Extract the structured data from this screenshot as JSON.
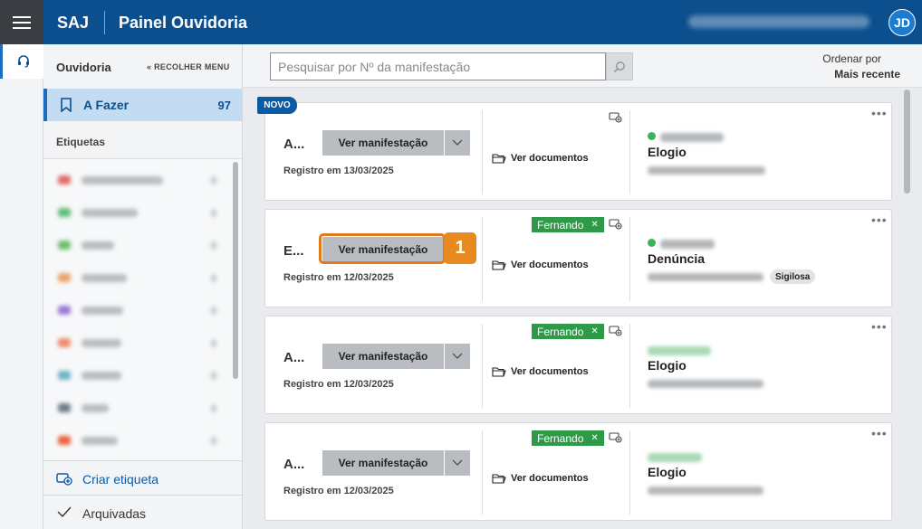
{
  "header": {
    "brand": "SAJ",
    "title": "Painel Ouvidoria",
    "avatar_initials": "JD"
  },
  "sidebar": {
    "title": "Ouvidoria",
    "collapse_label": "RECOLHER MENU",
    "afazer_label": "A Fazer",
    "afazer_count": "97",
    "tags_title": "Etiquetas",
    "create_label": "Criar etiqueta",
    "archived_label": "Arquivadas"
  },
  "search": {
    "placeholder": "Pesquisar por Nº da manifestação"
  },
  "sort": {
    "label": "Ordenar por",
    "value": "Mais recente"
  },
  "cards": [
    {
      "title": "A...",
      "badge": "NOVO",
      "button": "Ver manifestação",
      "registro": "Registro em 13/03/2025",
      "docs": "Ver documentos",
      "tag": "",
      "type": "Elogio",
      "confidential": ""
    },
    {
      "title": "E...",
      "badge": "",
      "button": "Ver manifestação",
      "registro": "Registro em 12/03/2025",
      "docs": "Ver documentos",
      "tag": "Fernando",
      "type": "Denúncia",
      "confidential": "Sigilosa"
    },
    {
      "title": "A...",
      "badge": "",
      "button": "Ver manifestação",
      "registro": "Registro em 12/03/2025",
      "docs": "Ver documentos",
      "tag": "Fernando",
      "type": "Elogio",
      "confidential": ""
    },
    {
      "title": "A...",
      "badge": "",
      "button": "Ver manifestação",
      "registro": "Registro em 12/03/2025",
      "docs": "Ver documentos",
      "tag": "Fernando",
      "type": "Elogio",
      "confidential": ""
    }
  ],
  "annotation": {
    "step": "1"
  },
  "colors": {
    "header_bg": "#0b4f8f",
    "accent": "#1b6dc1",
    "tag_green": "#2e9a47",
    "highlight_orange": "#e07b17"
  }
}
